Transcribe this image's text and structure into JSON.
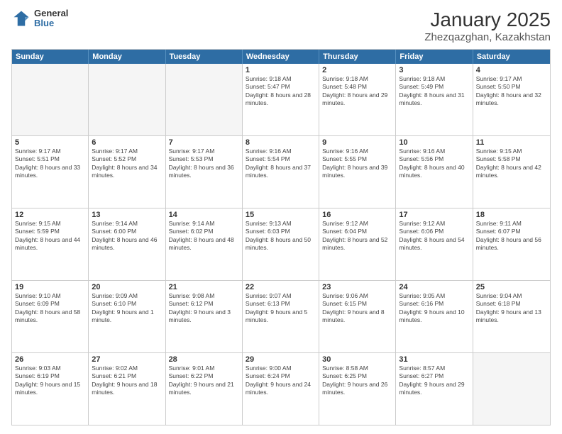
{
  "header": {
    "title": "January 2025",
    "subtitle": "Zhezqazghan, Kazakhstan",
    "logo_line1": "General",
    "logo_line2": "Blue"
  },
  "days_of_week": [
    "Sunday",
    "Monday",
    "Tuesday",
    "Wednesday",
    "Thursday",
    "Friday",
    "Saturday"
  ],
  "rows": [
    [
      {
        "day": "",
        "empty": true
      },
      {
        "day": "",
        "empty": true
      },
      {
        "day": "",
        "empty": true
      },
      {
        "day": "1",
        "sunrise": "9:18 AM",
        "sunset": "5:47 PM",
        "daylight": "8 hours and 28 minutes."
      },
      {
        "day": "2",
        "sunrise": "9:18 AM",
        "sunset": "5:48 PM",
        "daylight": "8 hours and 29 minutes."
      },
      {
        "day": "3",
        "sunrise": "9:18 AM",
        "sunset": "5:49 PM",
        "daylight": "8 hours and 31 minutes."
      },
      {
        "day": "4",
        "sunrise": "9:17 AM",
        "sunset": "5:50 PM",
        "daylight": "8 hours and 32 minutes."
      }
    ],
    [
      {
        "day": "5",
        "sunrise": "9:17 AM",
        "sunset": "5:51 PM",
        "daylight": "8 hours and 33 minutes."
      },
      {
        "day": "6",
        "sunrise": "9:17 AM",
        "sunset": "5:52 PM",
        "daylight": "8 hours and 34 minutes."
      },
      {
        "day": "7",
        "sunrise": "9:17 AM",
        "sunset": "5:53 PM",
        "daylight": "8 hours and 36 minutes."
      },
      {
        "day": "8",
        "sunrise": "9:16 AM",
        "sunset": "5:54 PM",
        "daylight": "8 hours and 37 minutes."
      },
      {
        "day": "9",
        "sunrise": "9:16 AM",
        "sunset": "5:55 PM",
        "daylight": "8 hours and 39 minutes."
      },
      {
        "day": "10",
        "sunrise": "9:16 AM",
        "sunset": "5:56 PM",
        "daylight": "8 hours and 40 minutes."
      },
      {
        "day": "11",
        "sunrise": "9:15 AM",
        "sunset": "5:58 PM",
        "daylight": "8 hours and 42 minutes."
      }
    ],
    [
      {
        "day": "12",
        "sunrise": "9:15 AM",
        "sunset": "5:59 PM",
        "daylight": "8 hours and 44 minutes."
      },
      {
        "day": "13",
        "sunrise": "9:14 AM",
        "sunset": "6:00 PM",
        "daylight": "8 hours and 46 minutes."
      },
      {
        "day": "14",
        "sunrise": "9:14 AM",
        "sunset": "6:02 PM",
        "daylight": "8 hours and 48 minutes."
      },
      {
        "day": "15",
        "sunrise": "9:13 AM",
        "sunset": "6:03 PM",
        "daylight": "8 hours and 50 minutes."
      },
      {
        "day": "16",
        "sunrise": "9:12 AM",
        "sunset": "6:04 PM",
        "daylight": "8 hours and 52 minutes."
      },
      {
        "day": "17",
        "sunrise": "9:12 AM",
        "sunset": "6:06 PM",
        "daylight": "8 hours and 54 minutes."
      },
      {
        "day": "18",
        "sunrise": "9:11 AM",
        "sunset": "6:07 PM",
        "daylight": "8 hours and 56 minutes."
      }
    ],
    [
      {
        "day": "19",
        "sunrise": "9:10 AM",
        "sunset": "6:09 PM",
        "daylight": "8 hours and 58 minutes."
      },
      {
        "day": "20",
        "sunrise": "9:09 AM",
        "sunset": "6:10 PM",
        "daylight": "9 hours and 1 minute."
      },
      {
        "day": "21",
        "sunrise": "9:08 AM",
        "sunset": "6:12 PM",
        "daylight": "9 hours and 3 minutes."
      },
      {
        "day": "22",
        "sunrise": "9:07 AM",
        "sunset": "6:13 PM",
        "daylight": "9 hours and 5 minutes."
      },
      {
        "day": "23",
        "sunrise": "9:06 AM",
        "sunset": "6:15 PM",
        "daylight": "9 hours and 8 minutes."
      },
      {
        "day": "24",
        "sunrise": "9:05 AM",
        "sunset": "6:16 PM",
        "daylight": "9 hours and 10 minutes."
      },
      {
        "day": "25",
        "sunrise": "9:04 AM",
        "sunset": "6:18 PM",
        "daylight": "9 hours and 13 minutes."
      }
    ],
    [
      {
        "day": "26",
        "sunrise": "9:03 AM",
        "sunset": "6:19 PM",
        "daylight": "9 hours and 15 minutes."
      },
      {
        "day": "27",
        "sunrise": "9:02 AM",
        "sunset": "6:21 PM",
        "daylight": "9 hours and 18 minutes."
      },
      {
        "day": "28",
        "sunrise": "9:01 AM",
        "sunset": "6:22 PM",
        "daylight": "9 hours and 21 minutes."
      },
      {
        "day": "29",
        "sunrise": "9:00 AM",
        "sunset": "6:24 PM",
        "daylight": "9 hours and 24 minutes."
      },
      {
        "day": "30",
        "sunrise": "8:58 AM",
        "sunset": "6:25 PM",
        "daylight": "9 hours and 26 minutes."
      },
      {
        "day": "31",
        "sunrise": "8:57 AM",
        "sunset": "6:27 PM",
        "daylight": "9 hours and 29 minutes."
      },
      {
        "day": "",
        "empty": true
      }
    ]
  ]
}
